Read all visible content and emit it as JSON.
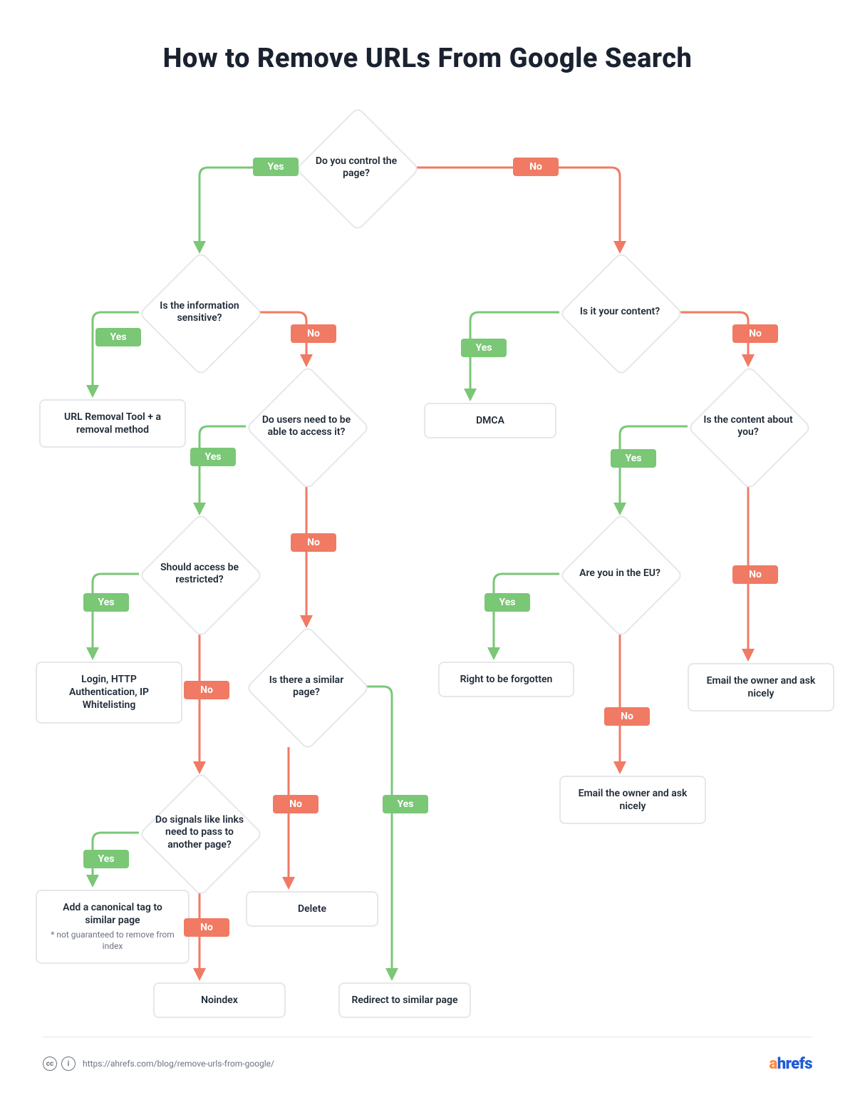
{
  "title": "How to Remove URLs From Google Search",
  "footer": {
    "attribution_url": "https://ahrefs.com/blog/remove-urls-from-google/",
    "brand_text": "ahrefs"
  },
  "colors": {
    "yes": "#7ac776",
    "no": "#f07a63",
    "border": "#e5e7eb",
    "brand_orange": "#ff8a3c",
    "brand_blue": "#1e5bd6"
  },
  "labels": {
    "yes": "Yes",
    "no": "No"
  },
  "decisions": {
    "d_control": {
      "text": "Do you control the page?"
    },
    "d_sensitive": {
      "text": "Is the information sensitive?"
    },
    "d_your_content": {
      "text": "Is it your content?"
    },
    "d_access": {
      "text": "Do users need to be able to access it?"
    },
    "d_about_you": {
      "text": "Is the content about you?"
    },
    "d_restricted": {
      "text": "Should access be restricted?"
    },
    "d_eu": {
      "text": "Are you in the EU?"
    },
    "d_similar": {
      "text": "Is there a similar page?"
    },
    "d_signals": {
      "text": "Do signals like links need to pass to another page?"
    }
  },
  "actions": {
    "a_urlremoval": {
      "text": "URL Removal Tool + a removal method"
    },
    "a_dmca": {
      "text": "DMCA"
    },
    "a_login": {
      "text": "Login, HTTP Authentication, IP Whitelisting"
    },
    "a_forgotten": {
      "text": "Right to be forgotten"
    },
    "a_email1": {
      "text": "Email the owner and ask nicely"
    },
    "a_email2": {
      "text": "Email the owner and ask nicely"
    },
    "a_canonical": {
      "text": "Add a canonical tag to similar page",
      "sub": "* not guaranteed to remove from index"
    },
    "a_delete": {
      "text": "Delete"
    },
    "a_noindex": {
      "text": "Noindex"
    },
    "a_redirect": {
      "text": "Redirect to similar page"
    }
  },
  "edges": [
    {
      "from": "d_control",
      "to": "d_sensitive",
      "answer": "yes"
    },
    {
      "from": "d_control",
      "to": "d_your_content",
      "answer": "no"
    },
    {
      "from": "d_sensitive",
      "to": "a_urlremoval",
      "answer": "yes"
    },
    {
      "from": "d_sensitive",
      "to": "d_access",
      "answer": "no"
    },
    {
      "from": "d_your_content",
      "to": "a_dmca",
      "answer": "yes"
    },
    {
      "from": "d_your_content",
      "to": "d_about_you",
      "answer": "no"
    },
    {
      "from": "d_access",
      "to": "d_restricted",
      "answer": "yes"
    },
    {
      "from": "d_access",
      "to": "d_similar",
      "answer": "no"
    },
    {
      "from": "d_about_you",
      "to": "d_eu",
      "answer": "yes"
    },
    {
      "from": "d_about_you",
      "to": "a_email1",
      "answer": "no"
    },
    {
      "from": "d_restricted",
      "to": "a_login",
      "answer": "yes"
    },
    {
      "from": "d_restricted",
      "to": "d_signals",
      "answer": "no"
    },
    {
      "from": "d_eu",
      "to": "a_forgotten",
      "answer": "yes"
    },
    {
      "from": "d_eu",
      "to": "a_email2",
      "answer": "no"
    },
    {
      "from": "d_similar",
      "to": "a_delete",
      "answer": "no"
    },
    {
      "from": "d_similar",
      "to": "a_redirect",
      "answer": "yes"
    },
    {
      "from": "d_signals",
      "to": "a_canonical",
      "answer": "yes"
    },
    {
      "from": "d_signals",
      "to": "a_noindex",
      "answer": "no"
    }
  ]
}
